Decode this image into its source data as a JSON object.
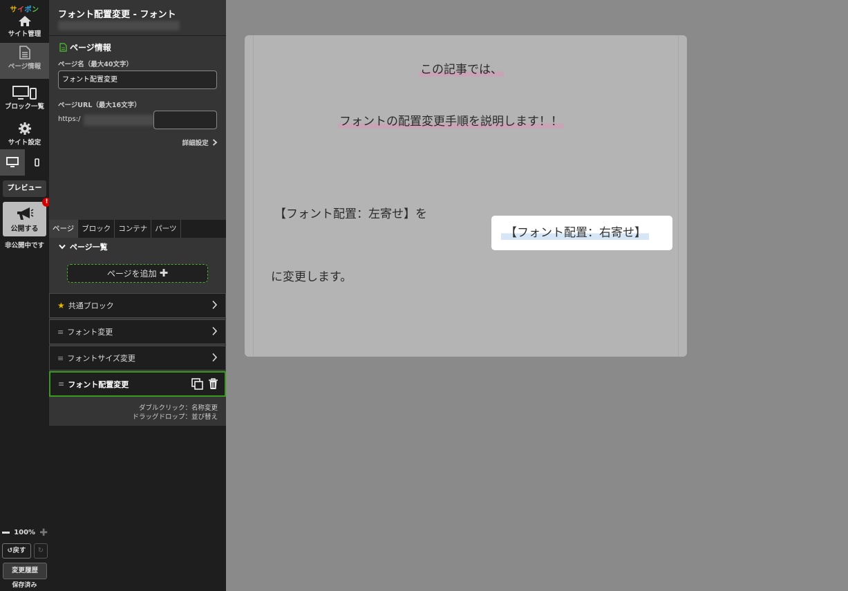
{
  "rail": {
    "logo": [
      "サ",
      "イ",
      "ポ",
      "ン"
    ],
    "site_manage": "サイト管理",
    "page_info": "ページ情報",
    "block_list": "ブロック一覧",
    "site_settings": "サイト設定",
    "preview": "プレビュー",
    "publish": "公開する",
    "publish_badge": "!",
    "unpublished": "非公開中です",
    "zoom": "100%",
    "undo": "戻す",
    "history": "変更履歴",
    "saved": "保存済み"
  },
  "panel": {
    "title": "フォント配置変更 - フォント",
    "section": "ページ情報",
    "page_name_label": "ページ名（最大40文字）",
    "page_name_value": "フォント配置変更",
    "page_url_label": "ページURL（最大16文字）",
    "url_prefix": "https:/",
    "detail_link": "詳細設定",
    "tabs": [
      "ページ",
      "ブロック",
      "コンテナ",
      "パーツ"
    ],
    "list_head": "ページ一覧",
    "add_page": "ページを追加",
    "pages": [
      "共通ブロック",
      "フォント変更",
      "フォントサイズ変更",
      "フォント配置変更"
    ],
    "hint_line1": "ダブルクリック：名称変更",
    "hint_line2": "ドラッグドロップ：並び替え"
  },
  "canvas": {
    "line1": "この記事では、",
    "line2": "フォントの配置変更手順を説明します！！",
    "line3": "【フォント配置：左寄せ】を",
    "line4": "【フォント配置：右寄せ】",
    "line5": "に変更します。"
  },
  "colors": {
    "accent_green": "#4caf2e",
    "badge_red": "#d40000",
    "highlight_pink": "#c9a3b6",
    "highlight_blue": "#d6e6f7"
  }
}
